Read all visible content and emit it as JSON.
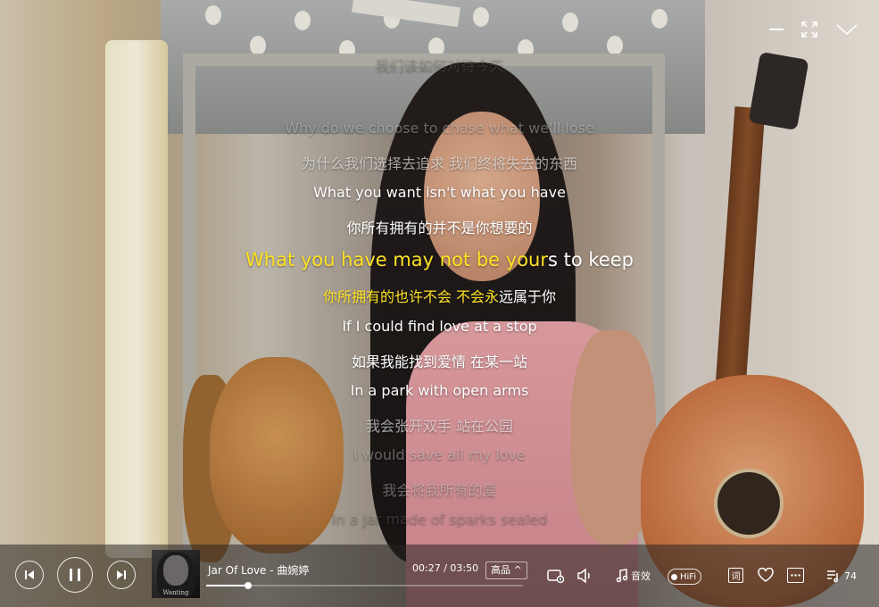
{
  "window": {
    "minimize_icon": "minimize-icon",
    "fullscreen_icon": "fullscreen-icon",
    "collapse_icon": "chevron-down-icon"
  },
  "lyrics": {
    "lines": [
      {
        "text": "我们该如何对待今天",
        "style": "dim1",
        "size": 16
      },
      {
        "text": "Why do we choose to chase what we'll lose",
        "style": "dim2",
        "size": 16
      },
      {
        "text": "为什么我们选择去追求 我们终将失去的东西",
        "style": "dim3",
        "size": 16
      },
      {
        "text": "What you want isn't what you have",
        "style": "normal",
        "size": 16
      },
      {
        "text": "你所有拥有的并不是你想要的",
        "style": "normal",
        "size": 16
      },
      {
        "text_highlight": "What you have may not be your",
        "text_rest": "s to keep",
        "style": "current",
        "size": 21
      },
      {
        "text_highlight": "你所拥有的也许不会 不会永",
        "text_rest": "远属于你",
        "style": "current-sub",
        "size": 16
      },
      {
        "text": "If I could find love at a stop",
        "style": "normal",
        "size": 16
      },
      {
        "text": "如果我能找到爱情 在某一站",
        "style": "normal",
        "size": 16
      },
      {
        "text": "In a park with open arms",
        "style": "normal",
        "size": 16
      },
      {
        "text": "我会张开双手 站在公园",
        "style": "dim3",
        "size": 16
      },
      {
        "text": "I would save all my love",
        "style": "dim2",
        "size": 16
      },
      {
        "text": "我会将我所有的爱",
        "style": "dim2",
        "size": 16
      },
      {
        "text": "In a jar made of sparks sealed",
        "style": "dim1",
        "size": 16
      }
    ],
    "highlight_color": "#ffe224"
  },
  "player": {
    "song_title": "Jar Of Love - 曲婉婷",
    "time_display": "00:27 / 03:50",
    "progress_fraction": 0.133,
    "quality_label": "高品 ^",
    "sound_effect_label": "音效",
    "hifi_label": "HiFi",
    "lyric_button_label": "词",
    "queue_count": "74",
    "album_logo_text": "Wanting"
  }
}
